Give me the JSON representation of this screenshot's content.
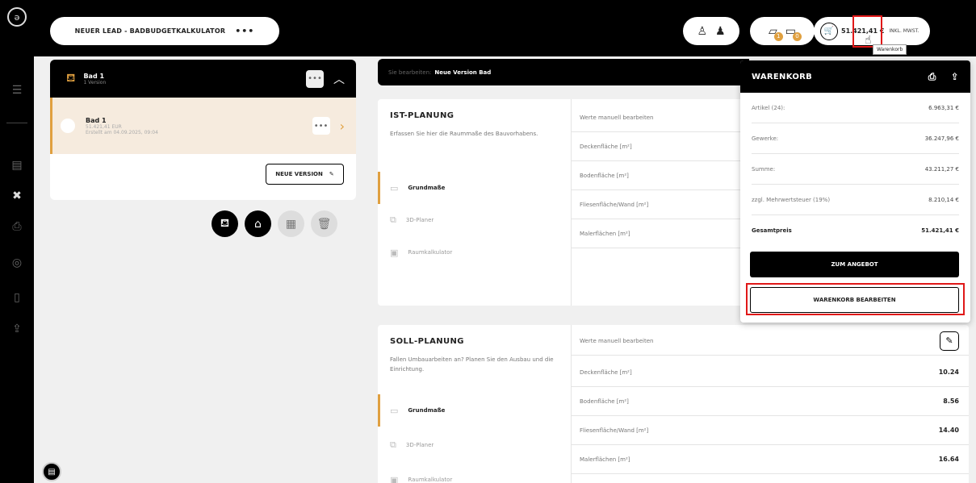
{
  "header": {
    "lead_title": "NEUER LEAD - BADBUDGETKALKULATOR",
    "lead_menu": "•••",
    "badge_1": "1",
    "badge_2": "0",
    "cart_price": "51.421,41 €",
    "cart_vat": "INKL. MWST.",
    "tooltip": "Warenkorb"
  },
  "bad": {
    "title": "Bad 1",
    "subtitle": "1 Version",
    "menu": "•••",
    "version": {
      "title": "Bad 1",
      "price": "51.421,41 EUR",
      "date": "Erstellt am 04.09.2025, 09:04"
    },
    "new_version_label": "NEUE VERSION"
  },
  "editbar": {
    "label": "Sie bearbeiten:",
    "value": "Neue Version Bad"
  },
  "ist": {
    "title": "IST-PLANUNG",
    "desc": "Erfassen Sie hier die Raummaße des Bauvorhabens.",
    "nav": [
      "Grundmaße",
      "3D-Planer",
      "Raumkalkulator"
    ],
    "rows": [
      {
        "label": "Werte manuell bearbeiten"
      },
      {
        "label": "Deckenfläche [m²]"
      },
      {
        "label": "Bodenfläche [m²]"
      },
      {
        "label": "Fliesenfläche/Wand [m²]"
      },
      {
        "label": "Malerflächen [m²]"
      }
    ]
  },
  "soll": {
    "title": "SOLL-PLANUNG",
    "desc": "Fallen Umbauarbeiten an? Planen Sie den Ausbau und die Einrichtung.",
    "nav": [
      "Grundmaße",
      "3D-Planer",
      "Raumkalkulator"
    ],
    "rows": [
      {
        "label": "Werte manuell bearbeiten",
        "value": ""
      },
      {
        "label": "Deckenfläche [m²]",
        "value": "10.24"
      },
      {
        "label": "Bodenfläche [m²]",
        "value": "8.56"
      },
      {
        "label": "Fliesenfläche/Wand [m²]",
        "value": "14.40"
      },
      {
        "label": "Malerflächen [m²]",
        "value": "16.64"
      }
    ]
  },
  "cart": {
    "title": "WARENKORB",
    "lines": [
      {
        "label": "Artikel (24):",
        "value": "6.963,31 €"
      },
      {
        "label": "Gewerke:",
        "value": "36.247,96 €"
      },
      {
        "label": "Summe:",
        "value": "43.211,27 €"
      },
      {
        "label": "zzgl. Mehrwertsteuer (19%)",
        "value": "8.210,14 €"
      },
      {
        "label": "Gesamtpreis",
        "value": "51.421,41 €"
      }
    ],
    "offer_button": "ZUM ANGEBOT",
    "edit_button": "WARENKORB BEARBEITEN"
  },
  "colors": {
    "accent": "#e0a040",
    "highlight": "#e01818"
  }
}
